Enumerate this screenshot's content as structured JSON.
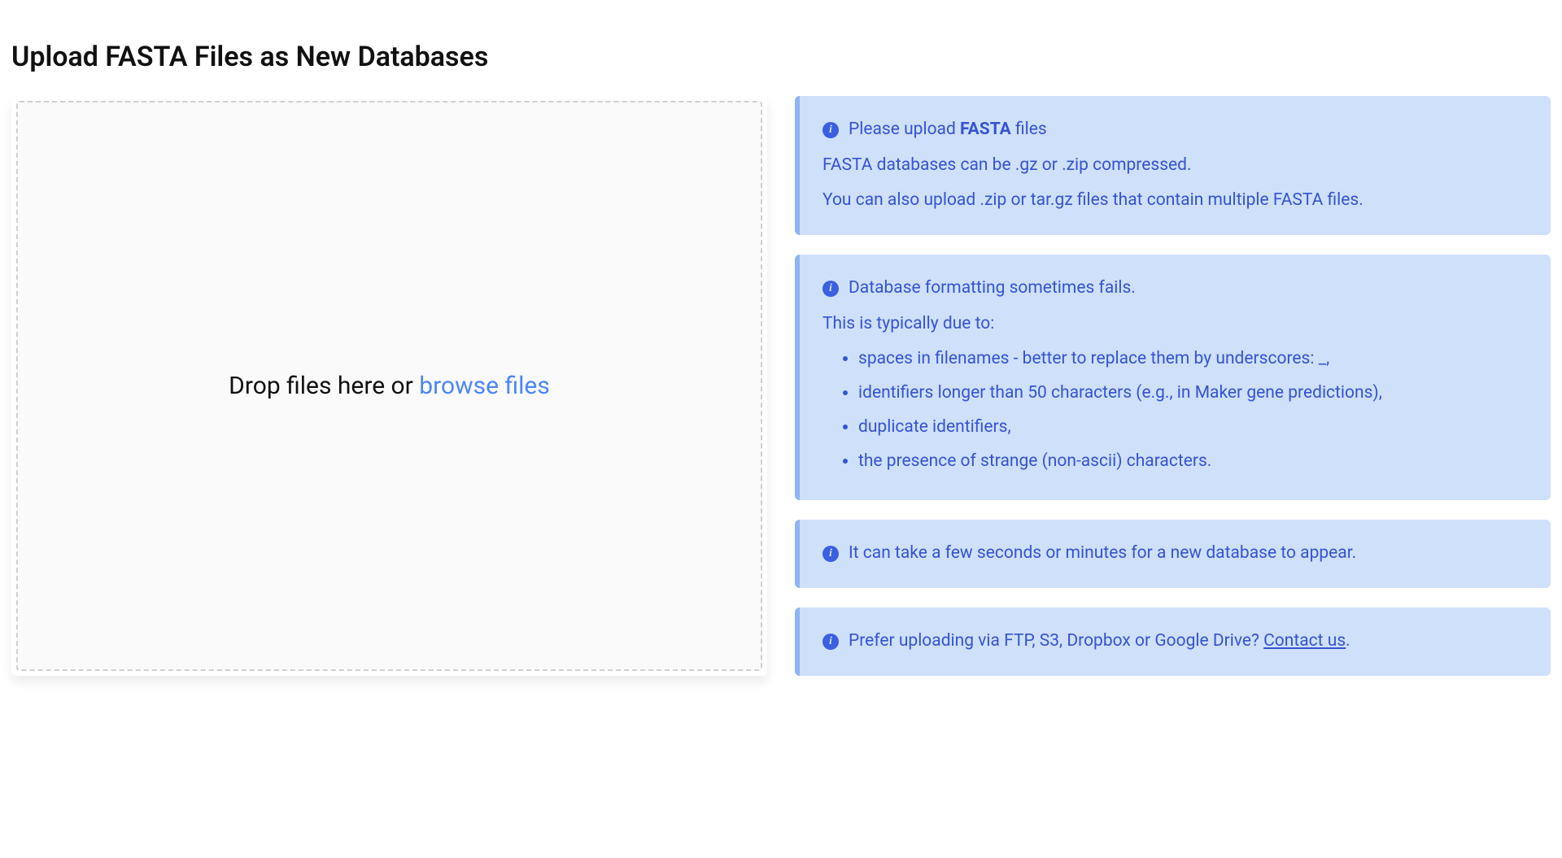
{
  "page_title": "Upload FASTA Files as New Databases",
  "dropzone": {
    "text_prefix": "Drop files here or ",
    "browse_label": "browse files"
  },
  "info": {
    "box1": {
      "lead_prefix": "Please upload ",
      "lead_bold": "FASTA",
      "lead_suffix": " files",
      "line2": "FASTA databases can be .gz or .zip compressed.",
      "line3": "You can also upload .zip or tar.gz files that contain multiple FASTA files."
    },
    "box2": {
      "lead": "Database formatting sometimes fails.",
      "subhead": "This is typically due to:",
      "reasons": [
        "spaces in filenames - better to replace them by underscores: _,",
        "identifiers longer than 50 characters (e.g., in Maker gene predictions),",
        "duplicate identifiers,",
        "the presence of strange (non-ascii) characters."
      ]
    },
    "box3": {
      "lead": "It can take a few seconds or minutes for a new database to appear."
    },
    "box4": {
      "lead_prefix": "Prefer uploading via FTP, S3, Dropbox or Google Drive? ",
      "link_label": "Contact us",
      "lead_suffix": "."
    }
  }
}
